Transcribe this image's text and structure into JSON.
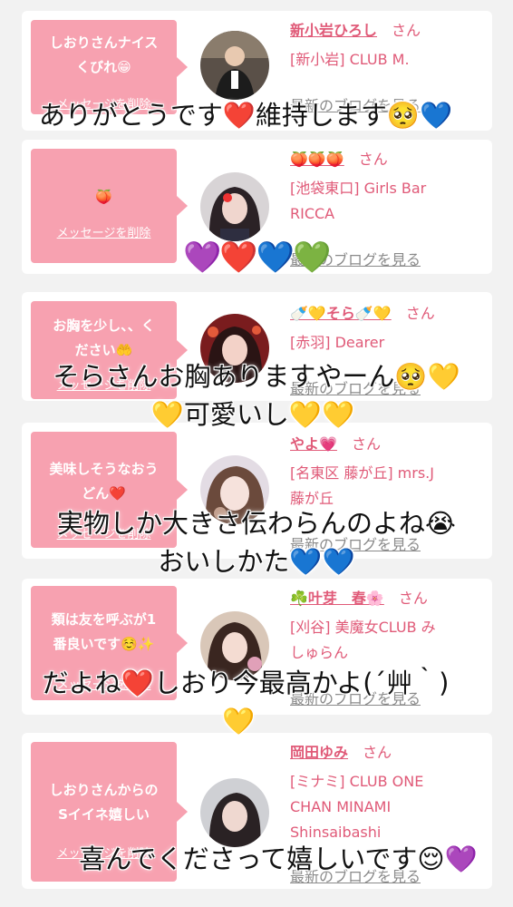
{
  "delete_label": "メッセージを削除",
  "blog_label": "最新のブログを見る",
  "san_label": "さん",
  "messages": [
    {
      "bubble": "しおりさんナイス\nくびれ😁",
      "name": "新小岩ひろし",
      "shop": "[新小岩] CLUB M."
    },
    {
      "bubble": "🍑",
      "name": "🍑🍑🍑",
      "shop": "[池袋東口] Girls Bar\nRICCA"
    },
    {
      "bubble": "お胸を少し、、く\nださい🤲",
      "name": "🍼💛そら🍼💛",
      "shop": "[赤羽] Dearer"
    },
    {
      "bubble": "美味しそうなおう\nどん❤️",
      "name": "やよ💗",
      "shop": "[名東区 藤が丘] mrs.J\n藤が丘"
    },
    {
      "bubble": "類は友を呼ぶが1\n番良いです☺️✨",
      "name": "☘️叶芽　春🌸",
      "shop": "[刈谷] 美魔女CLUB み\nしゅらん"
    },
    {
      "bubble": "しおりさんからの\nSイイネ嬉しい",
      "name": "岡田ゆみ",
      "shop": "[ミナミ] CLUB ONE\nCHAN MINAMI\nShinsaibashi"
    }
  ],
  "captions": {
    "c1": "ありがとうです❤️維持します🥺💙",
    "c2": "💜❤️💙💚",
    "c3a": "そらさんお胸ありますやーん🥺💛",
    "c3b": "💛可愛いし💛💛",
    "c4a": "実物しか大きさ伝わらんのよね😭",
    "c4b": "おいしかた💙💙",
    "c5a": "だよね❤️しおり今最高かよ(´艸｀)",
    "c5b": "💛",
    "c6": "喜んでくださって嬉しいです😌💜"
  }
}
